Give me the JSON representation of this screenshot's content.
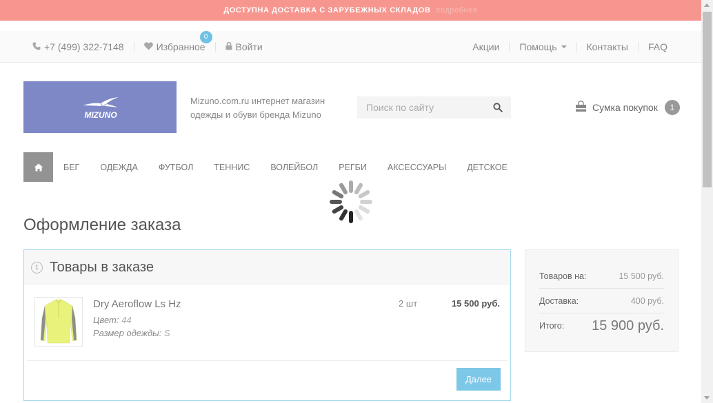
{
  "promo": {
    "text": "ДОСТУПНА ДОСТАВКА С ЗАРУБЕЖНЫХ СКЛАДОВ",
    "details": "подробнее"
  },
  "topbar": {
    "phone": "+7 (499) 322-7148",
    "favorites_label": "Избранное",
    "favorites_count": "0",
    "login_label": "Войти",
    "links": [
      "Акции",
      "Помощь",
      "Контакты",
      "FAQ"
    ]
  },
  "header": {
    "logo_text": "MIZUNO",
    "tagline": "Mizuno.com.ru интернет магазин одежды и обуви бренда Mizuno",
    "search_placeholder": "Поиск по сайту",
    "cart_label": "Сумка покупок",
    "cart_count": "1"
  },
  "nav": {
    "items": [
      "БЕГ",
      "ОДЕЖДА",
      "ФУТБОЛ",
      "ТЕННИС",
      "ВОЛЕЙБОЛ",
      "РЕГБИ",
      "АКСЕССУАРЫ",
      "ДЕТСКОЕ"
    ]
  },
  "page": {
    "title": "Оформление заказа"
  },
  "order": {
    "step_number": "1",
    "section_title": "Товары в заказе",
    "product": {
      "name": "Dry Aeroflow Ls Hz",
      "color_label": "Цвет:",
      "color_value": "44",
      "size_label": "Размер одежды:",
      "size_value": "S",
      "quantity": "2 шт",
      "price": "15 500 руб."
    },
    "next_button": "Далее"
  },
  "summary": {
    "items_label": "Товаров на:",
    "items_value": "15 500 руб.",
    "delivery_label": "Доставка:",
    "delivery_value": "400 руб.",
    "total_label": "Итого:",
    "total_value": "15 900 руб."
  },
  "colors": {
    "promo_bar": "#f7968f",
    "logo_bg": "#7e88c6",
    "accent_blue": "#7dc7e8",
    "order_border": "#a6d8ea"
  }
}
